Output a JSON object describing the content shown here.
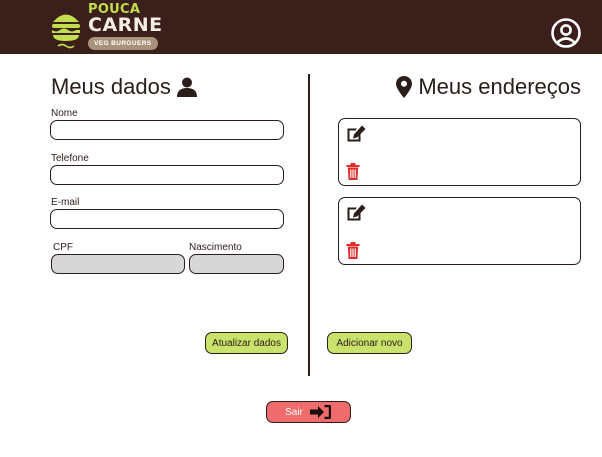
{
  "header": {
    "logo": {
      "line1": "POUCA",
      "line2": "CARNE",
      "tagline": "VEG BURGUERS"
    },
    "profile_icon": "user-circle-icon"
  },
  "profile": {
    "title": "Meus dados",
    "title_icon": "user-icon",
    "fields": {
      "nome": {
        "label": "Nome",
        "value": ""
      },
      "telefone": {
        "label": "Telefone",
        "value": ""
      },
      "email": {
        "label": "E-mail",
        "value": ""
      },
      "cpf": {
        "label": "CPF",
        "value": "",
        "disabled": true
      },
      "nascimento": {
        "label": "Nascimento",
        "value": "",
        "disabled": true
      }
    },
    "update_button": "Atualizar dados"
  },
  "addresses": {
    "title": "Meus endereços",
    "title_icon": "map-marker-icon",
    "cards": [
      {
        "edit_icon": "edit-icon",
        "delete_icon": "trash-icon",
        "text": ""
      },
      {
        "edit_icon": "edit-icon",
        "delete_icon": "trash-icon",
        "text": ""
      }
    ],
    "add_button": "Adicionar novo"
  },
  "logout": {
    "label": "Sair",
    "icon": "sign-in-icon"
  },
  "colors": {
    "header_bg": "#3b1f1a",
    "accent_green": "#c8e26b",
    "logo_green": "#c3dd4f",
    "logout_red": "#f06b6b",
    "delete_red": "#e02b2b",
    "text_dark": "#2b1d1a",
    "disabled_field": "#d7d7d7"
  }
}
